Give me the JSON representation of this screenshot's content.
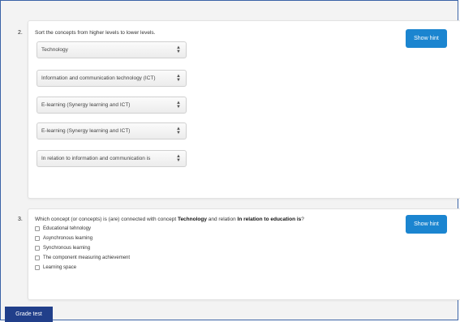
{
  "q2": {
    "number": "2.",
    "prompt": "Sort the concepts from higher levels to lower levels.",
    "hint_label": "Show hint",
    "selects": [
      "Technology",
      "Information and communication technology (ICT)",
      "E-learning (Synergy learning and ICT)",
      "E-learning (Synergy learning and ICT)",
      "In relation to information and communication is"
    ]
  },
  "q3": {
    "number": "3.",
    "prompt_a": "Which concept (or concepts) is (are) connected with concept ",
    "prompt_b": "Technology",
    "prompt_c": " and relation ",
    "prompt_d": "In relation to education is",
    "prompt_e": "?",
    "hint_label": "Show hint",
    "options": [
      "Educational tehnology",
      "Asynchronous learning",
      "Synchronous learning",
      "The component measuring achievement",
      "Learning space"
    ]
  },
  "grade_label": "Grade test"
}
